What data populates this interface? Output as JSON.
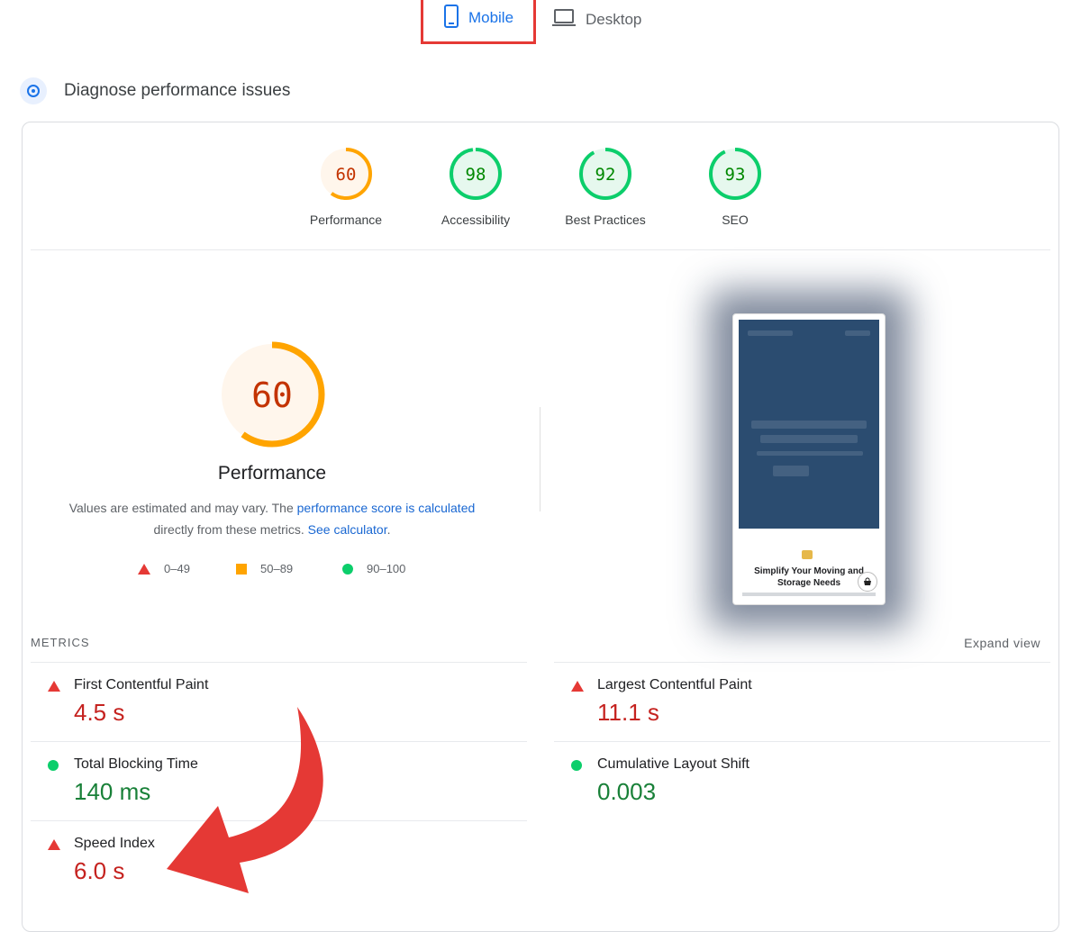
{
  "tabs": {
    "mobile": "Mobile",
    "desktop": "Desktop"
  },
  "section_title": "Diagnose performance issues",
  "scores": [
    {
      "label": "Performance",
      "value": "60",
      "fraction": 0.6,
      "status": "average"
    },
    {
      "label": "Accessibility",
      "value": "98",
      "fraction": 0.98,
      "status": "pass"
    },
    {
      "label": "Best Practices",
      "value": "92",
      "fraction": 0.92,
      "status": "pass"
    },
    {
      "label": "SEO",
      "value": "93",
      "fraction": 0.93,
      "status": "pass"
    }
  ],
  "main": {
    "score": "60",
    "fraction": 0.6,
    "label": "Performance",
    "desc_1": "Values are estimated and may vary. The ",
    "desc_link_1": "performance score is calculated",
    "desc_2": "directly from these metrics. ",
    "desc_link_2": "See calculator",
    "desc_end": "."
  },
  "legend": {
    "fail": "0–49",
    "average": "50–89",
    "pass": "90–100"
  },
  "screenshot": {
    "headline": "Simplify Your Moving and Storage Needs"
  },
  "metrics": {
    "heading": "METRICS",
    "expand": "Expand view",
    "items": [
      {
        "title": "First Contentful Paint",
        "value": "4.5 s",
        "status": "fail"
      },
      {
        "title": "Largest Contentful Paint",
        "value": "11.1 s",
        "status": "fail"
      },
      {
        "title": "Total Blocking Time",
        "value": "140 ms",
        "status": "pass"
      },
      {
        "title": "Cumulative Layout Shift",
        "value": "0.003",
        "status": "pass"
      },
      {
        "title": "Speed Index",
        "value": "6.0 s",
        "status": "fail"
      }
    ]
  },
  "colors": {
    "fail": "#e53935",
    "average": "#ffa400",
    "pass": "#0cce6b",
    "link": "#1967d2",
    "tab_highlight": "#e53935"
  }
}
